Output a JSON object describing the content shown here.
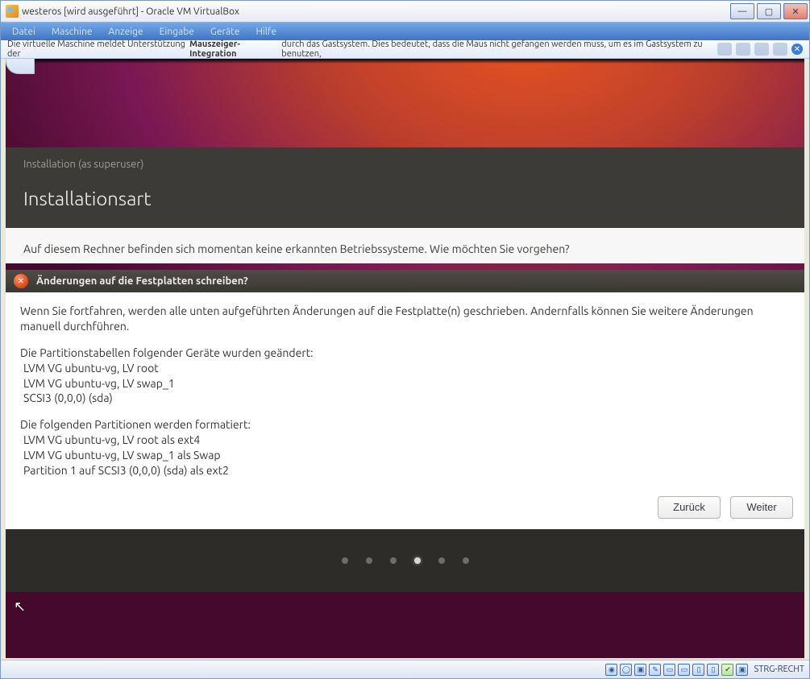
{
  "window": {
    "title": "westeros [wird ausgeführt] - Oracle VM VirtualBox"
  },
  "win_controls": {
    "min": "—",
    "max": "▢",
    "close": "✕"
  },
  "menubar": [
    "Datei",
    "Maschine",
    "Anzeige",
    "Eingabe",
    "Geräte",
    "Hilfe"
  ],
  "infobar": {
    "pre": "Die virtuelle Maschine meldet Unterstützung der ",
    "bold": "Mauszeiger-Integration",
    "post": " durch das Gastsystem. Dies bedeutet, dass die Maus nicht gefangen werden muss, um es im Gastsystem zu benutzen,"
  },
  "installer": {
    "subtitle": "Installation (as superuser)",
    "heading": "Installationsart",
    "body_line": "Auf diesem Rechner befinden sich momentan keine erkannten Betriebssysteme. Wie möchten Sie vorgehen?"
  },
  "dialog": {
    "title": "Änderungen auf die Festplatten schreiben?",
    "intro": "Wenn Sie fortfahren, werden alle unten aufgeführten Änderungen auf die Festplatte(n) geschrieben. Andernfalls können Sie weitere Änderungen manuell durchführen.",
    "section1_title": "Die Partitionstabellen folgender Geräte wurden geändert:",
    "section1_items": [
      "LVM VG ubuntu-vg, LV root",
      "LVM VG ubuntu-vg, LV swap_1",
      "SCSI3 (0,0,0) (sda)"
    ],
    "section2_title": "Die folgenden Partitionen werden formatiert:",
    "section2_items": [
      "LVM VG ubuntu-vg, LV root als ext4",
      "LVM VG ubuntu-vg, LV swap_1 als Swap",
      "Partition 1 auf SCSI3 (0,0,0) (sda) als ext2"
    ],
    "btn_back": "Zurück",
    "btn_next": "Weiter"
  },
  "progress": {
    "total": 6,
    "active": 3
  },
  "statusbar": {
    "host_key": "STRG-RECHT"
  }
}
